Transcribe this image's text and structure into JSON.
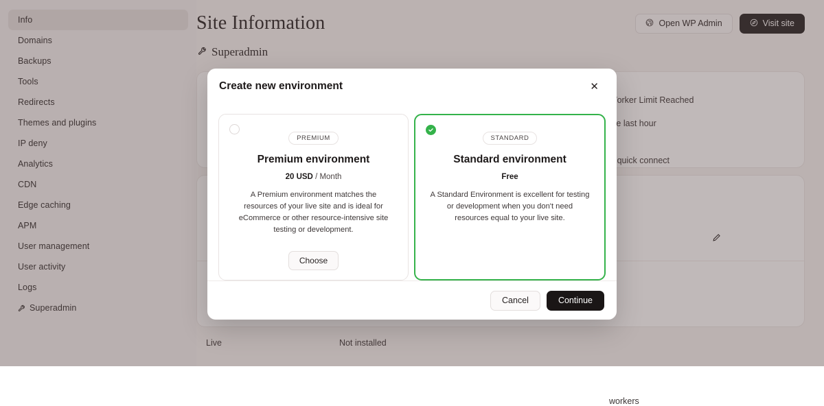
{
  "colors": {
    "overlay": "#ACA0A0",
    "accent_green": "#34B24A",
    "dark_button": "#231F1F",
    "sidebar_bg": "#F4F1F0"
  },
  "sidebar": {
    "items": [
      {
        "label": "Info",
        "active": true,
        "icon": null
      },
      {
        "label": "Domains",
        "active": false,
        "icon": null
      },
      {
        "label": "Backups",
        "active": false,
        "icon": null
      },
      {
        "label": "Tools",
        "active": false,
        "icon": null
      },
      {
        "label": "Redirects",
        "active": false,
        "icon": null
      },
      {
        "label": "Themes and plugins",
        "active": false,
        "icon": null
      },
      {
        "label": "IP deny",
        "active": false,
        "icon": null
      },
      {
        "label": "Analytics",
        "active": false,
        "icon": null
      },
      {
        "label": "CDN",
        "active": false,
        "icon": null
      },
      {
        "label": "Edge caching",
        "active": false,
        "icon": null
      },
      {
        "label": "APM",
        "active": false,
        "icon": null
      },
      {
        "label": "User management",
        "active": false,
        "icon": null
      },
      {
        "label": "User activity",
        "active": false,
        "icon": null
      },
      {
        "label": "Logs",
        "active": false,
        "icon": null
      },
      {
        "label": "Superadmin",
        "active": false,
        "icon": "wrench-icon"
      }
    ]
  },
  "header": {
    "title": "Site Information",
    "open_wp_admin_label": "Open WP Admin",
    "open_wp_admin_icon": "wordpress-icon",
    "visit_site_label": "Visit site",
    "visit_site_icon": "compass-icon"
  },
  "background": {
    "superadmin_card_title": "Superadmin",
    "superadmin_card_icon": "wrench-icon",
    "row_1": "Worker Limit Reached",
    "row_2": "the last hour",
    "row_3": "P quick connect",
    "row_4": "workers",
    "edit_icon": "pencil-icon",
    "footer_left": "Live",
    "footer_right": "Not installed"
  },
  "modal": {
    "title": "Create new environment",
    "close_icon": "close-icon",
    "options": [
      {
        "badge": "PREMIUM",
        "title": "Premium environment",
        "price_amount": "20 USD",
        "price_unit": "/ Month",
        "description": "A Premium environment matches the resources of your live site and is ideal for eCommerce or other resource-intensive site testing or development.",
        "selected": false,
        "action_label": "Choose"
      },
      {
        "badge": "STANDARD",
        "title": "Standard environment",
        "price_amount": "Free",
        "price_unit": "",
        "description": "A Standard Environment is excellent for testing or development when you don't need resources equal to your live site.",
        "selected": true,
        "action_label": null
      }
    ],
    "cancel_label": "Cancel",
    "continue_label": "Continue"
  }
}
